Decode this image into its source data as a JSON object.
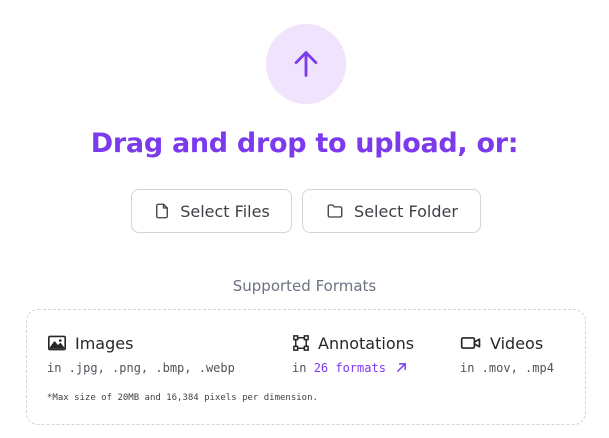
{
  "upload": {
    "icon": "arrow-up-icon",
    "headline": "Drag and drop to upload, or:",
    "accent_color": "#7c3aed",
    "circle_color": "#efe3fd"
  },
  "buttons": {
    "select_files": {
      "label": "Select Files",
      "icon": "file-icon"
    },
    "select_folder": {
      "label": "Select Folder",
      "icon": "folder-icon"
    }
  },
  "formats": {
    "title": "Supported Formats",
    "images": {
      "label": "Images",
      "icon": "image-icon",
      "extensions": "in .jpg, .png, .bmp, .webp"
    },
    "annotations": {
      "label": "Annotations",
      "icon": "bounding-box-icon",
      "prefix": "in",
      "link_text": "26 formats",
      "link_icon": "arrow-up-right-icon"
    },
    "videos": {
      "label": "Videos",
      "icon": "video-icon",
      "extensions": "in .mov, .mp4"
    },
    "footnote": "*Max size of 20MB and 16,384 pixels per dimension."
  }
}
